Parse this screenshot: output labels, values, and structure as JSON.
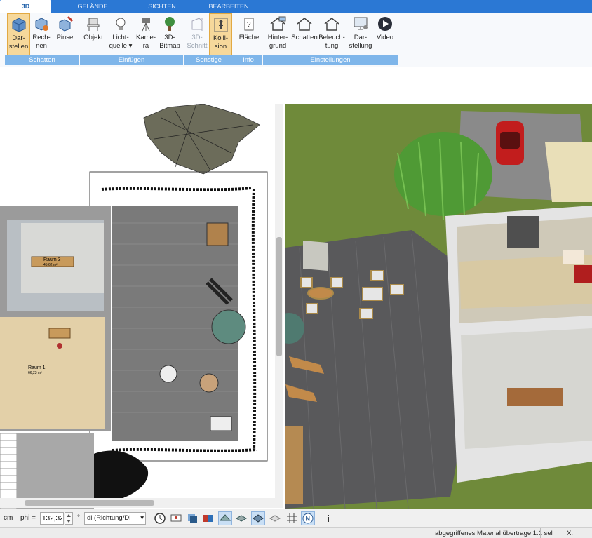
{
  "tabs": [
    "3D",
    "GELÄNDE",
    "SICHTEN",
    "BEARBEITEN"
  ],
  "ribbon": {
    "buttons": [
      {
        "label1": "Dar-",
        "label2": "stellen"
      },
      {
        "label1": "Rech-",
        "label2": "nen"
      },
      {
        "label1": "Pinsel",
        "label2": ""
      },
      {
        "label1": "Objekt",
        "label2": ""
      },
      {
        "label1": "Licht-",
        "label2": "quelle ▾"
      },
      {
        "label1": "Kame-",
        "label2": "ra"
      },
      {
        "label1": "3D-",
        "label2": "Bitmap"
      },
      {
        "label1": "3D-",
        "label2": "Schnitt"
      },
      {
        "label1": "Kolli-",
        "label2": "sion"
      },
      {
        "label1": "Fläche",
        "label2": ""
      },
      {
        "label1": "Hinter-",
        "label2": "grund"
      },
      {
        "label1": "Schatten",
        "label2": ""
      },
      {
        "label1": "Beleuch-",
        "label2": "tung"
      },
      {
        "label1": "Dar-",
        "label2": "stellung"
      },
      {
        "label1": "Video",
        "label2": ""
      }
    ],
    "groups": [
      "Schatten",
      "Einfügen",
      "Sonstige",
      "Info",
      "Einstellungen"
    ]
  },
  "plan": {
    "room1_name": "Raum 1",
    "room1_area": "66,23 m²",
    "room3_name": "Raum 3",
    "room3_area": "45,62 m²"
  },
  "toolbar": {
    "unit": "cm",
    "phi_label": "phi =",
    "phi_value": "132,32",
    "degree": "°",
    "direction_value": "dl (Richtung/Di"
  },
  "status": {
    "message": "abgegriffenes Material übertrage 1:1 sel",
    "coord_label": "X:"
  },
  "colors": {
    "ribbon_blue": "#2b78d4",
    "group_label": "#7fb6ea",
    "active_button": "#f6d89b",
    "grass": "#6f8a3a",
    "deck": "#59595b"
  }
}
